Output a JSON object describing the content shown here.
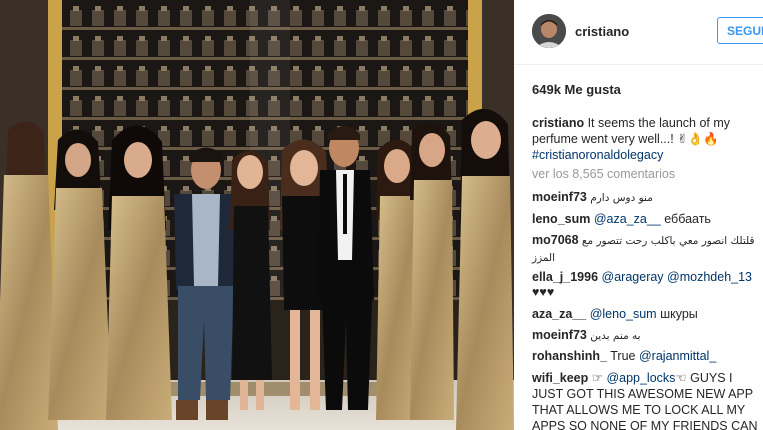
{
  "post": {
    "author": "cristiano",
    "follow_label": "SEGUI",
    "likes": "649k Me gusta",
    "caption_user": "cristiano",
    "caption_text": " It seems the launch of my perfume went very well...! ✌👌🔥",
    "caption_tag": "#cristianoronaldolegacy",
    "view_all": "ver los 8,565 comentarios"
  },
  "comments": [
    {
      "user": "moeinf73",
      "text": " منو دوس دارم"
    },
    {
      "user": "leno_sum",
      "mention": "@aza_za__",
      "text": " еббаать"
    },
    {
      "user": "mo7068",
      "text": " قلتلك انصور معي باكلب رحت تتصور مع المزز"
    },
    {
      "user": "ella_j_1996",
      "mention": "@arageray",
      "mention2": "@mozhdeh_13"
    },
    {
      "user": "",
      "text": "♥♥♥"
    },
    {
      "user": "aza_za__",
      "mention": "@leno_sum",
      "text": " шкуры"
    },
    {
      "user": "moeinf73",
      "text": " به منم بدین"
    },
    {
      "user": "rohanshinh_",
      "text": " True ",
      "mention": "@rajanmittal_"
    },
    {
      "user": "wifi_keep",
      "text": " ☞ ",
      "mention": "@app_locks",
      "text2": "☜ GUYS I JUST GOT THIS AWESOME NEW APP THAT ALLOWS ME TO LOCK ALL MY APPS SO NONE OF MY FRIENDS CAN OPEN"
    }
  ],
  "colors": {
    "link_blue": "#3897f0",
    "mention_blue": "#003569",
    "muted_gray": "#999999",
    "text": "#262626"
  },
  "icons": [
    "avatar-image"
  ]
}
